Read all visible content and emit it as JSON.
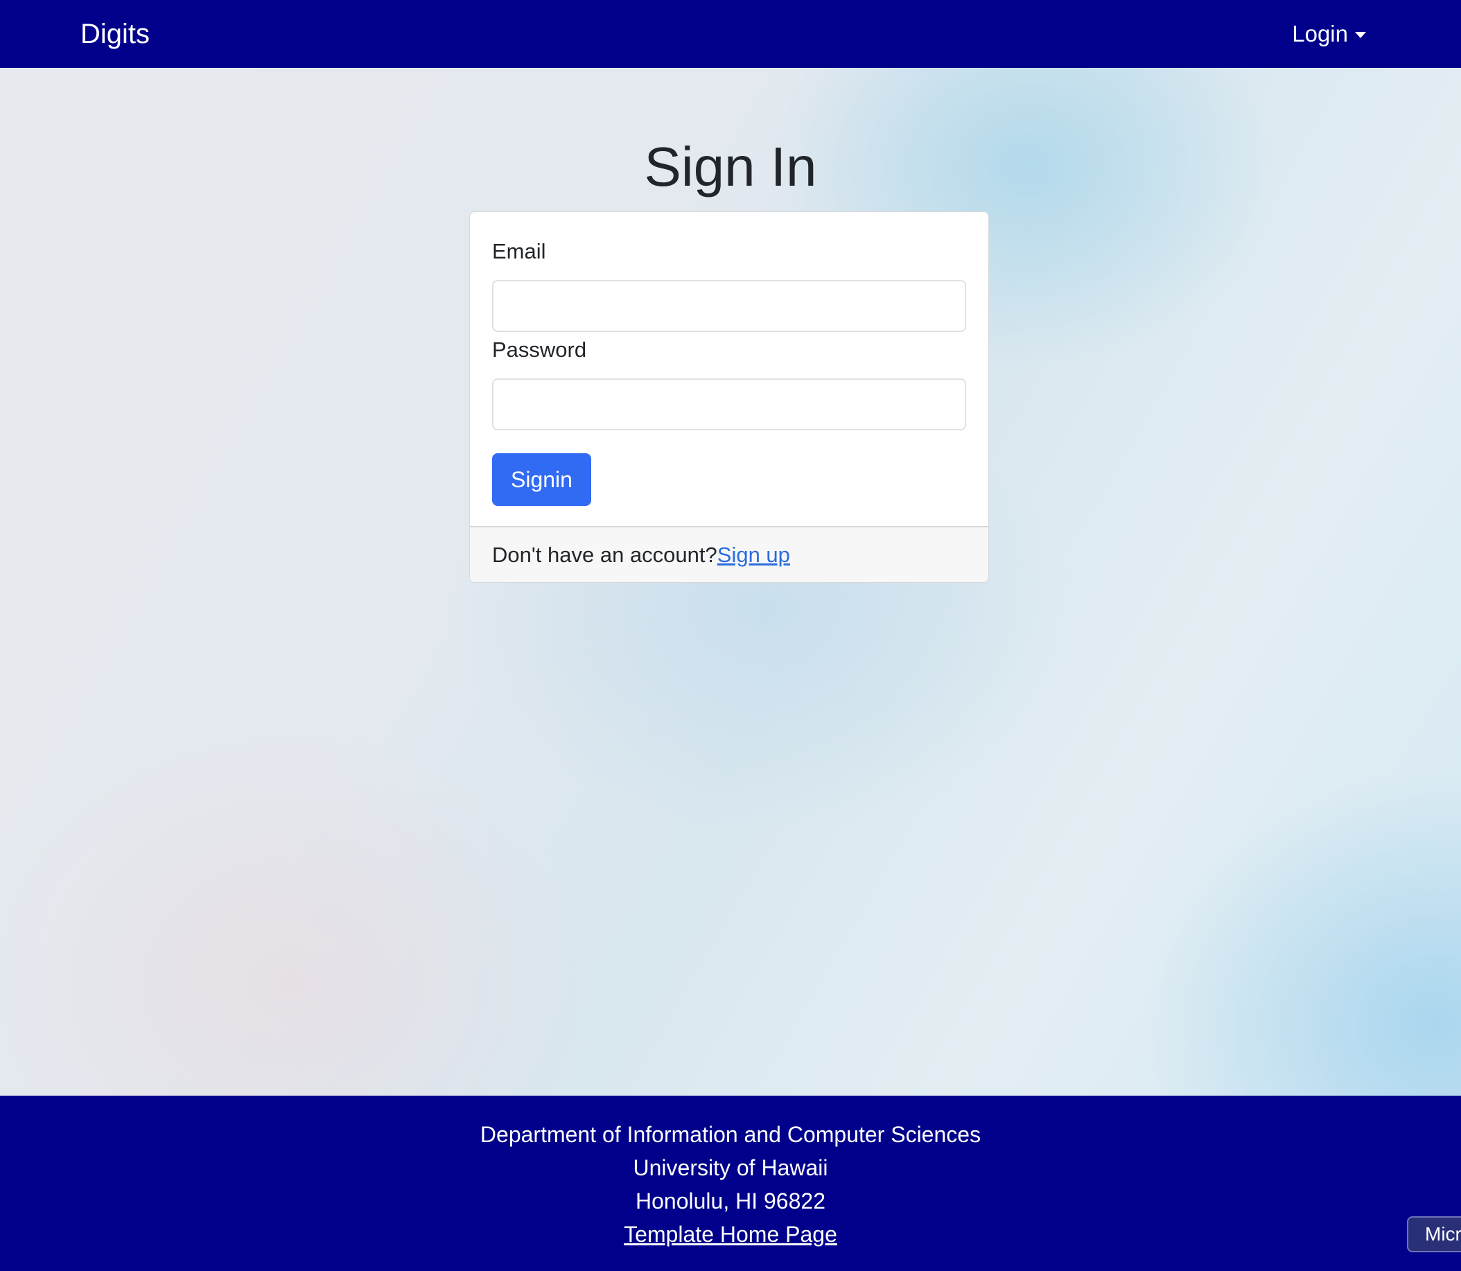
{
  "navbar": {
    "brand": "Digits",
    "login_label": "Login"
  },
  "page": {
    "title": "Sign In"
  },
  "form": {
    "email_label": "Email",
    "email_value": "",
    "password_label": "Password",
    "password_value": "",
    "signin_label": "Signin",
    "no_account_text": "Don't have an account?",
    "signup_label": "Sign up"
  },
  "footer": {
    "line1": "Department of Information and Computer Sciences",
    "line2": "University of Hawaii",
    "line3": "Honolulu, HI 96822",
    "link_label": "Template Home Page"
  },
  "corner_button": {
    "label": "Micr"
  },
  "colors": {
    "navbar_bg": "#00008b",
    "primary_button": "#316af3",
    "link": "#2a6be0"
  },
  "icons": {
    "login_caret": "caret-down-icon"
  }
}
